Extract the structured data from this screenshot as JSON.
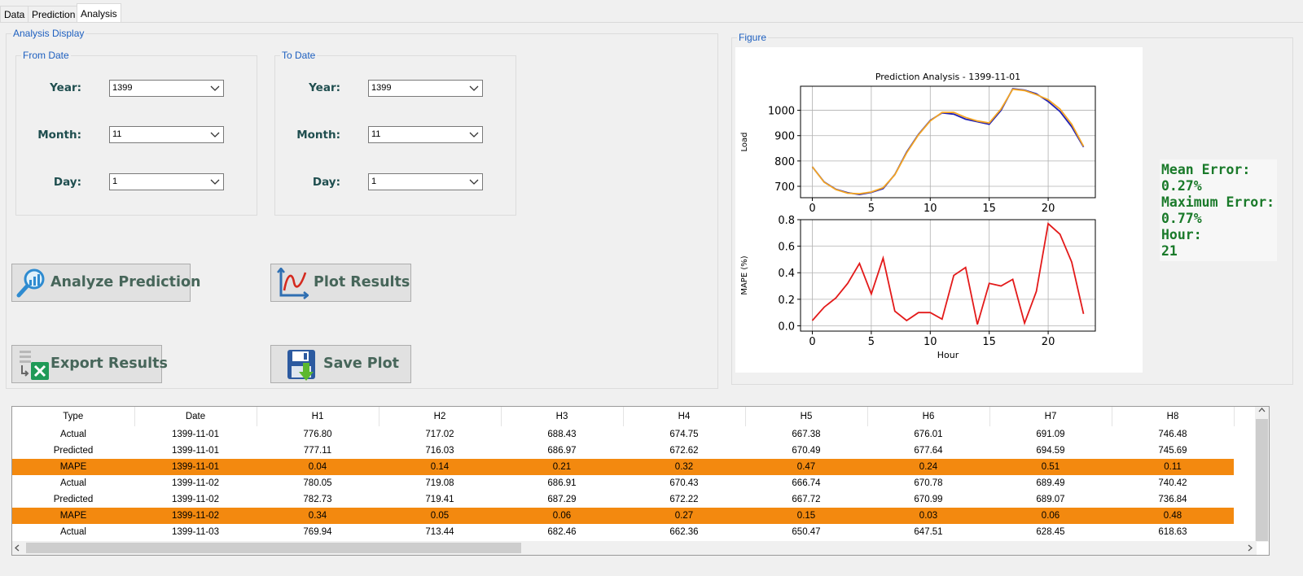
{
  "tabs": [
    {
      "label": "Data"
    },
    {
      "label": "Prediction"
    },
    {
      "label": "Analysis"
    }
  ],
  "analysis_display": {
    "title": "Analysis Display",
    "from_date": {
      "title": "From Date",
      "year_label": "Year:",
      "year_value": "1399",
      "month_label": "Month:",
      "month_value": "11",
      "day_label": "Day:",
      "day_value": "1"
    },
    "to_date": {
      "title": "To Date",
      "year_label": "Year:",
      "year_value": "1399",
      "month_label": "Month:",
      "month_value": "11",
      "day_label": "Day:",
      "day_value": "1"
    },
    "buttons": {
      "analyze": "Analyze Prediction",
      "plot": "Plot Results",
      "export": "Export Results",
      "save_plot": "Save Plot"
    }
  },
  "figure": {
    "title": "Figure",
    "stats": {
      "mean_error_label": "Mean Error:",
      "mean_error_value": "0.27%",
      "max_error_label": "Maximum Error:",
      "max_error_value": "0.77%",
      "hour_label": "Hour:",
      "hour_value": "21"
    }
  },
  "chart_data": [
    {
      "type": "line",
      "title": "Prediction Analysis - 1399-11-01",
      "xlabel": "",
      "ylabel": "Load",
      "xlim": [
        -1,
        24
      ],
      "ylim": [
        655,
        1095
      ],
      "xticks": [
        0,
        5,
        10,
        15,
        20
      ],
      "yticks": [
        700,
        800,
        900,
        1000
      ],
      "grid": true,
      "x": [
        0,
        1,
        2,
        3,
        4,
        5,
        6,
        7,
        8,
        9,
        10,
        11,
        12,
        13,
        14,
        15,
        16,
        17,
        18,
        19,
        20,
        21,
        22,
        23
      ],
      "series": [
        {
          "color": "#1f1fb4",
          "values": [
            776.8,
            717.02,
            688.43,
            674.75,
            667.38,
            676.01,
            691.09,
            746.48,
            835,
            905,
            960,
            990,
            985,
            965,
            955,
            945,
            1000,
            1085,
            1080,
            1065,
            1035,
            995,
            935,
            855
          ]
        },
        {
          "color": "#f5a623",
          "values": [
            777.11,
            716.03,
            686.97,
            672.62,
            670.49,
            677.64,
            694.59,
            745.69,
            832,
            903,
            958,
            992,
            992,
            972,
            958,
            950,
            1005,
            1083,
            1078,
            1062,
            1042,
            1005,
            945,
            858
          ]
        }
      ]
    },
    {
      "type": "line",
      "title": "",
      "xlabel": "Hour",
      "ylabel": "MAPE (%)",
      "xlim": [
        -1,
        24
      ],
      "ylim": [
        -0.04,
        0.8
      ],
      "xticks": [
        0,
        5,
        10,
        15,
        20
      ],
      "yticks": [
        0.0,
        0.2,
        0.4,
        0.6,
        0.8
      ],
      "grid": true,
      "x": [
        0,
        1,
        2,
        3,
        4,
        5,
        6,
        7,
        8,
        9,
        10,
        11,
        12,
        13,
        14,
        15,
        16,
        17,
        18,
        19,
        20,
        21,
        22,
        23
      ],
      "series": [
        {
          "color": "#e31a1a",
          "values": [
            0.04,
            0.14,
            0.21,
            0.32,
            0.47,
            0.24,
            0.51,
            0.11,
            0.04,
            0.1,
            0.1,
            0.05,
            0.38,
            0.44,
            0.01,
            0.32,
            0.3,
            0.35,
            0.02,
            0.26,
            0.77,
            0.69,
            0.48,
            0.09
          ]
        }
      ]
    }
  ],
  "table": {
    "columns": [
      "Type",
      "Date",
      "H1",
      "H2",
      "H3",
      "H4",
      "H5",
      "H6",
      "H7",
      "H8"
    ],
    "rows": [
      [
        "Actual",
        "1399-11-01",
        "776.80",
        "717.02",
        "688.43",
        "674.75",
        "667.38",
        "676.01",
        "691.09",
        "746.48"
      ],
      [
        "Predicted",
        "1399-11-01",
        "777.11",
        "716.03",
        "686.97",
        "672.62",
        "670.49",
        "677.64",
        "694.59",
        "745.69"
      ],
      [
        "MAPE",
        "1399-11-01",
        "0.04",
        "0.14",
        "0.21",
        "0.32",
        "0.47",
        "0.24",
        "0.51",
        "0.11"
      ],
      [
        "Actual",
        "1399-11-02",
        "780.05",
        "719.08",
        "686.91",
        "670.43",
        "666.74",
        "670.78",
        "689.49",
        "740.42"
      ],
      [
        "Predicted",
        "1399-11-02",
        "782.73",
        "719.41",
        "687.29",
        "672.22",
        "667.72",
        "670.99",
        "689.07",
        "736.84"
      ],
      [
        "MAPE",
        "1399-11-02",
        "0.34",
        "0.05",
        "0.06",
        "0.27",
        "0.15",
        "0.03",
        "0.06",
        "0.48"
      ],
      [
        "Actual",
        "1399-11-03",
        "769.94",
        "713.44",
        "682.46",
        "662.36",
        "650.47",
        "647.51",
        "628.45",
        "618.63"
      ]
    ]
  },
  "colors": {
    "mape_row": "#f3890f",
    "group_title": "#1d5fbf",
    "stats_text": "#1a7a2a"
  }
}
